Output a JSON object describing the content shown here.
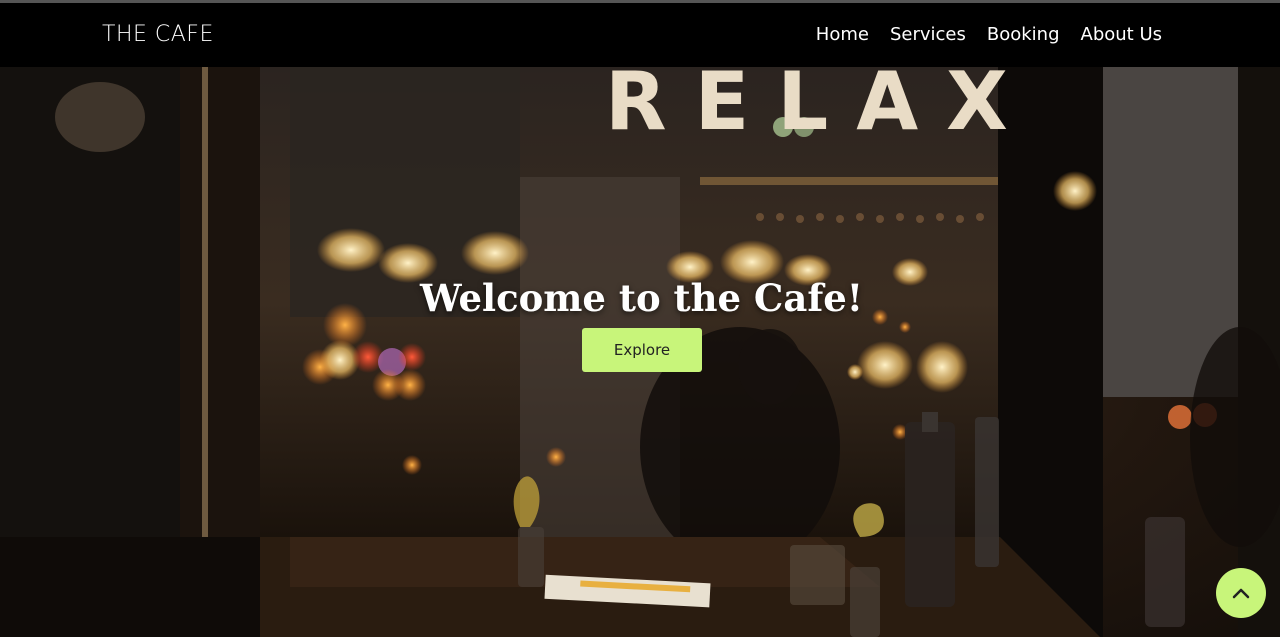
{
  "brand": {
    "name": "THE CAFE"
  },
  "nav": {
    "items": [
      {
        "label": "Home"
      },
      {
        "label": "Services"
      },
      {
        "label": "Booking"
      },
      {
        "label": "About Us"
      }
    ]
  },
  "hero": {
    "title": "Welcome to the Cafe!",
    "button_label": "Explore",
    "sign_text": "RELAX"
  },
  "scroll_top": {
    "icon": "chevron-up-icon"
  },
  "colors": {
    "accent": "#c8f57a",
    "navbar": "#000000",
    "text": "#ffffff"
  }
}
